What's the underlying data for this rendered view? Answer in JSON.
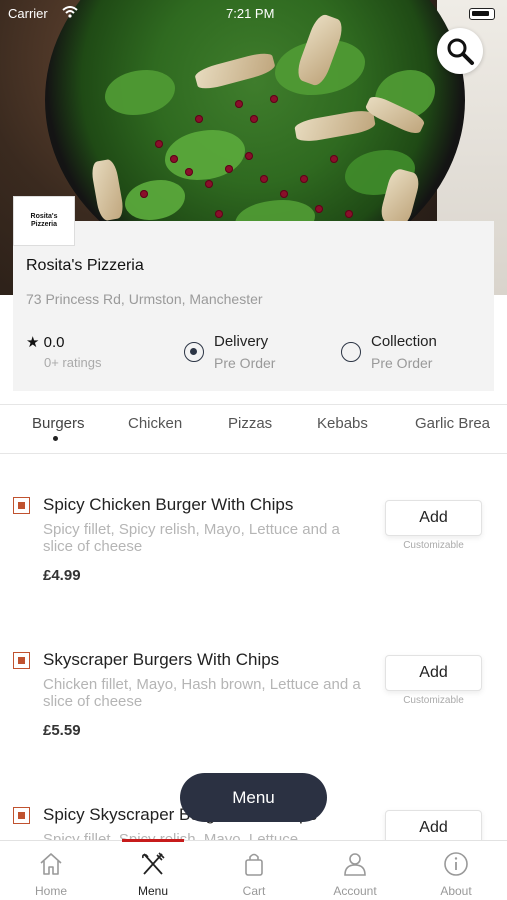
{
  "status_bar": {
    "carrier": "Carrier",
    "time": "7:21 PM"
  },
  "restaurant": {
    "logo_text": "Rosita's Pizzeria",
    "name": "Rosita's Pizzeria",
    "address": "73 Princess Rd, Urmston, Manchester",
    "rating": "0.0",
    "ratings_count": "0+ ratings",
    "options": [
      {
        "label": "Delivery",
        "sub": "Pre Order",
        "selected": true
      },
      {
        "label": "Collection",
        "sub": "Pre Order",
        "selected": false
      }
    ]
  },
  "categories": [
    "Burgers",
    "Chicken",
    "Pizzas",
    "Kebabs",
    "Garlic Brea"
  ],
  "active_category": "Burgers",
  "items": [
    {
      "title": "Spicy Chicken Burger With Chips",
      "desc": "Spicy fillet, Spicy relish, Mayo, Lettuce and a slice of cheese",
      "price": "£4.99",
      "add_label": "Add",
      "custom_label": "Customizable"
    },
    {
      "title": "Skyscraper Burgers With Chips",
      "desc": "Chicken fillet, Mayo, Hash brown, Lettuce and a slice of cheese",
      "price": "£5.59",
      "add_label": "Add",
      "custom_label": "Customizable"
    },
    {
      "title": "Spicy Skyscraper Burger With Chips",
      "desc": "Spicy fillet, Spicy relish, Mayo, Lettuce",
      "price": "",
      "add_label": "Add",
      "custom_label": ""
    }
  ],
  "floating_menu_label": "Menu",
  "bottom_nav": [
    {
      "label": "Home",
      "icon": "home-icon"
    },
    {
      "label": "Menu",
      "icon": "fork-knife-icon",
      "active": true
    },
    {
      "label": "Cart",
      "icon": "bag-icon"
    },
    {
      "label": "Account",
      "icon": "person-icon"
    },
    {
      "label": "About",
      "icon": "info-icon"
    }
  ],
  "colors": {
    "accent": "#c71b1b",
    "dark": "#2b3142",
    "veg": "#c0522f"
  }
}
